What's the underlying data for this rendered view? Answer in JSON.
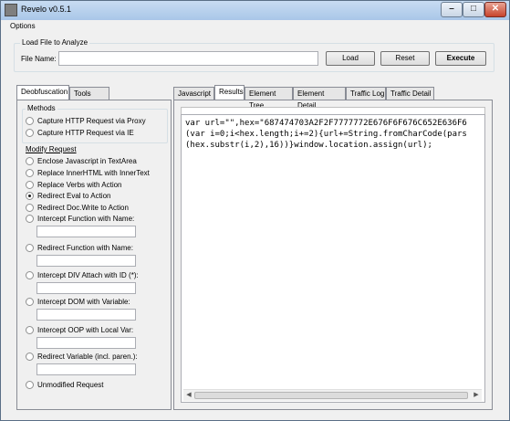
{
  "window": {
    "title": "Revelo v0.5.1"
  },
  "menu": {
    "options": "Options"
  },
  "load_group": {
    "title": "Load File to Analyze",
    "file_name_label": "File Name:",
    "file_name_value": "",
    "load_button": "Load",
    "reset_button": "Reset",
    "execute_button": "Execute"
  },
  "left_tabs": [
    "Deobfuscation",
    "Tools"
  ],
  "methods": {
    "title": "Methods",
    "options": [
      "Capture HTTP Request via Proxy",
      "Capture HTTP Request via IE"
    ]
  },
  "modify_request": {
    "title": "Modify Request",
    "options": [
      "Enclose Javascript in TextArea",
      "Replace InnerHTML with InnerText",
      "Replace Verbs with Action",
      "Redirect Eval to Action",
      "Redirect Doc.Write to Action",
      "Intercept Function with Name:",
      "Redirect Function with Name:",
      "Intercept DIV Attach with ID (*):",
      "Intercept DOM with Variable:",
      "Intercept OOP with Local Var:",
      "Redirect Variable (incl. paren.):",
      "Unmodified Request"
    ],
    "selected": "Redirect Eval to Action"
  },
  "right_tabs": [
    "Javascript",
    "Results",
    "Element Tree",
    "Element Detail",
    "Traffic Log",
    "Traffic Detail"
  ],
  "active_right_tab": "Results",
  "code_lines": [
    "var url=\"\",hex=\"687474703A2F2F7777772E676F6F676C652E636F6",
    "(var i=0;i<hex.length;i+=2){url+=String.fromCharCode(pars",
    "(hex.substr(i,2),16))}window.location.assign(url);"
  ]
}
